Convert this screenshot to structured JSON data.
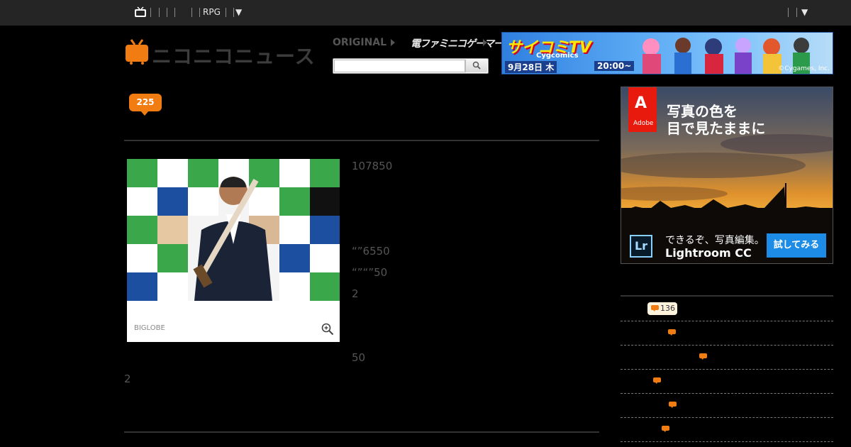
{
  "topbar": {
    "tv_icon": "niconico-tv-icon",
    "rpg_label": "RPG",
    "caret": "▼"
  },
  "header": {
    "logo_text": "ニコニコニュース",
    "nav_original": "ORIGINAL",
    "nav_famicom": "電ファミニコゲーマー",
    "search_placeholder": "",
    "search_icon": "magnifier-icon"
  },
  "banner_top": {
    "title": "サイコミTV",
    "subtitle": "Cygcomics",
    "date": "9月28日 木",
    "time": "20:00~",
    "copyright": "©Cygames, Inc.",
    "accent": "#2f7fe0"
  },
  "article": {
    "comment_count": "225",
    "photo_credit": "BIGLOBE",
    "zoom_icon": "zoom-in-icon",
    "text_lines": [
      "107850",
      "“”6550",
      "“”“”50",
      "2",
      "50",
      "2"
    ]
  },
  "sidebar": {
    "ad": {
      "brand_logo": "Adobe",
      "headline_1": "写真の色を",
      "headline_2": "目で見たままに",
      "product_icon": "Lr",
      "tagline": "できるぞ、写真編集。",
      "product": "Lightroom CC",
      "cta": "試してみる"
    },
    "ranking_top_count": "136",
    "accent": "#f07c12"
  }
}
